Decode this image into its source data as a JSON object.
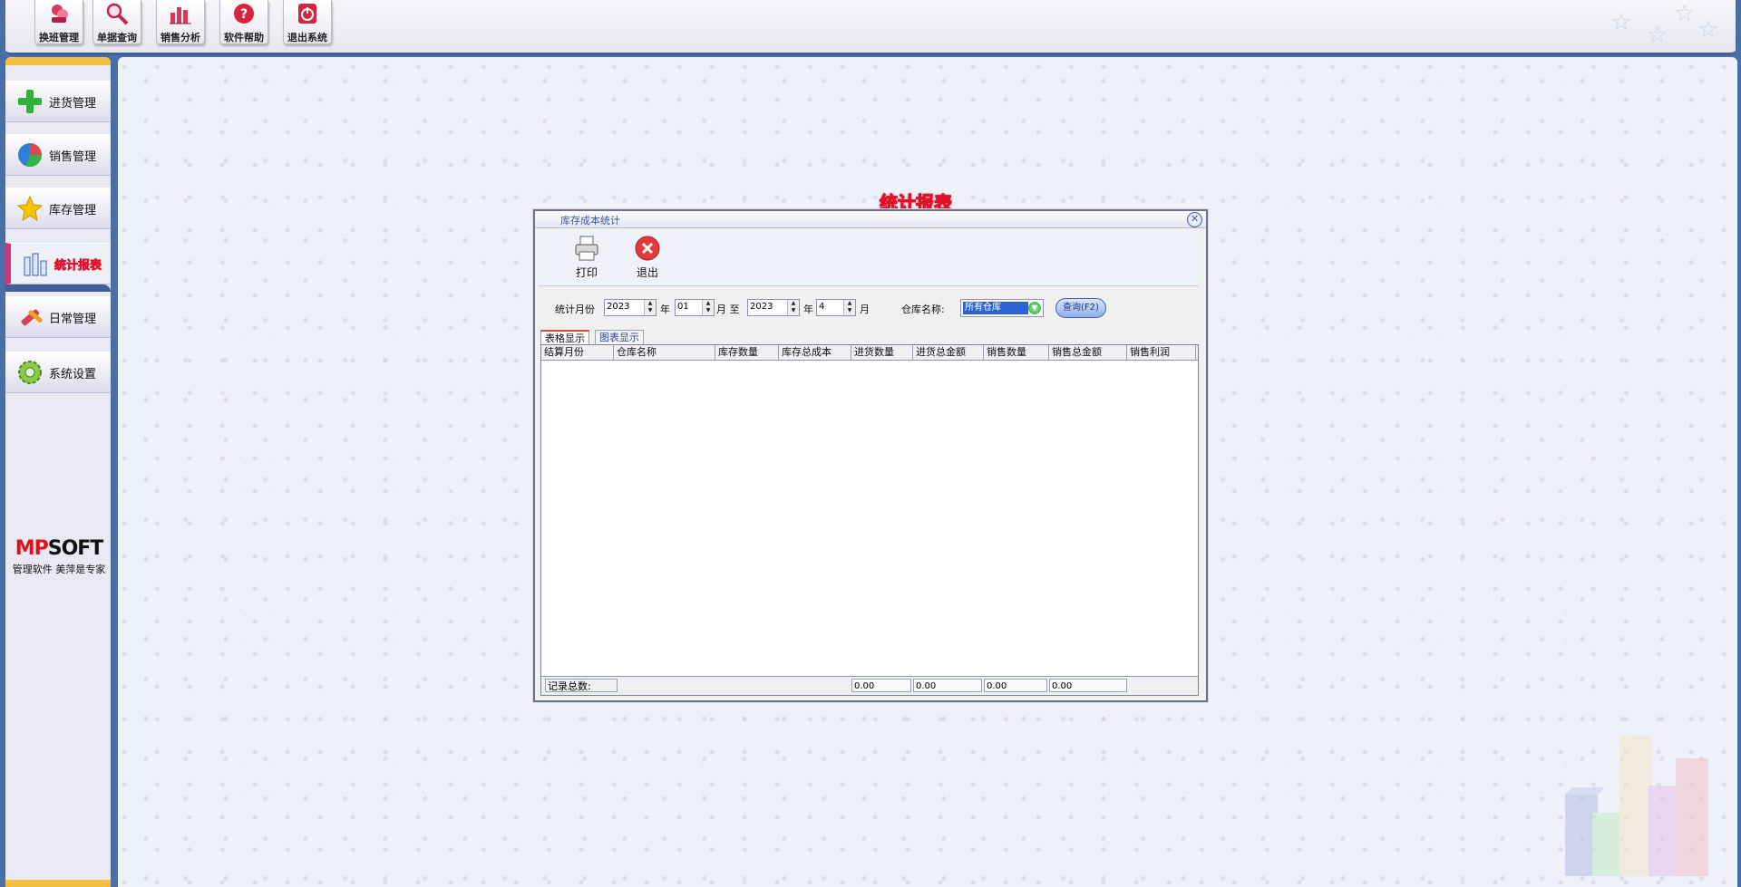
{
  "toolbar": {
    "buttons": [
      {
        "label": "换班管理",
        "icon": "shift-change-icon"
      },
      {
        "label": "单据查询",
        "icon": "document-search-icon"
      },
      {
        "label": "销售分析",
        "icon": "sales-chart-icon"
      },
      {
        "label": "软件帮助",
        "icon": "help-icon"
      },
      {
        "label": "退出系统",
        "icon": "power-icon"
      }
    ]
  },
  "sidebar": {
    "items": [
      {
        "label": "进货管理",
        "icon": "plus-icon"
      },
      {
        "label": "销售管理",
        "icon": "pie-icon"
      },
      {
        "label": "库存管理",
        "icon": "star-icon"
      },
      {
        "label": "统计报表",
        "icon": "bar-chart-icon",
        "active": true
      },
      {
        "label": "日常管理",
        "icon": "wrench-icon"
      },
      {
        "label": "系统设置",
        "icon": "gear-icon"
      }
    ],
    "logo": {
      "brand_red": "MP",
      "brand_black": "SOFT",
      "slogan": "管理软件 美萍是专家"
    }
  },
  "main": {
    "title": "统计报表"
  },
  "dialog": {
    "title": "库存成本统计",
    "toolbar": {
      "print_label": "打印",
      "exit_label": "退出"
    },
    "filters": {
      "label_month": "统计月份",
      "from_year": "2023",
      "year_label": "年",
      "from_month": "01",
      "month_to_label": "月 至",
      "to_year": "2023",
      "year_label2": "年",
      "to_month": "4",
      "month_label": "月",
      "warehouse_label": "仓库名称:",
      "warehouse_value": "所有仓库",
      "query_label": "查询(F2)"
    },
    "tabs": [
      {
        "label": "表格显示",
        "active": true
      },
      {
        "label": "图表显示",
        "active": false
      }
    ],
    "grid": {
      "columns": [
        "结算月份",
        "仓库名称",
        "库存数量",
        "库存总成本",
        "进货数量",
        "进货总金额",
        "销售数量",
        "销售总金额",
        "销售利润"
      ],
      "rows": []
    },
    "footer": {
      "record_count_label": "记录总数:",
      "sums": [
        "0.00",
        "0.00",
        "0.00",
        "0.00"
      ]
    }
  },
  "colors": {
    "accent_red": "#e0102a",
    "frame_blue": "#3f5f96",
    "nav_yellow": "#f3c041"
  }
}
